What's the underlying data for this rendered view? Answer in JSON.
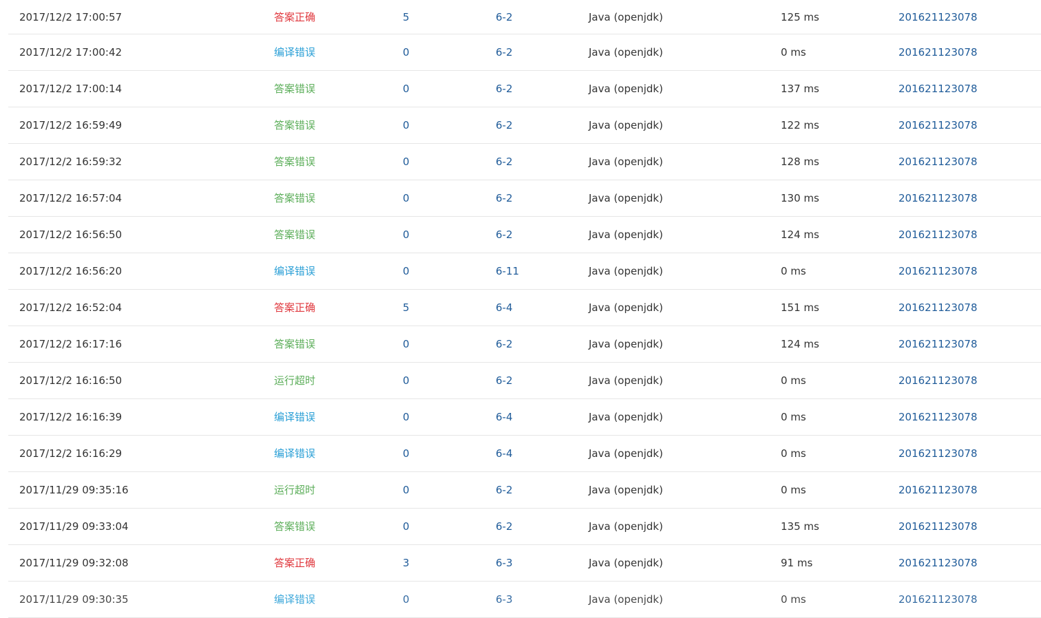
{
  "colors": {
    "correct": "#e0383e",
    "compile_error": "#2a9fd6",
    "wrong_answer": "#5cae5a",
    "timeout": "#5cae5a",
    "link": "#1f5b99",
    "text": "#333333",
    "divider": "#e6e6e6"
  },
  "rows": [
    {
      "time": "2017/12/2 17:00:57",
      "status": "答案正确",
      "score": "5",
      "problem": "6-2",
      "lang": "Java (openjdk)",
      "ms": "125 ms",
      "user": "201621123078"
    },
    {
      "time": "2017/12/2 17:00:42",
      "status": "编译错误",
      "score": "0",
      "problem": "6-2",
      "lang": "Java (openjdk)",
      "ms": "0 ms",
      "user": "201621123078"
    },
    {
      "time": "2017/12/2 17:00:14",
      "status": "答案错误",
      "score": "0",
      "problem": "6-2",
      "lang": "Java (openjdk)",
      "ms": "137 ms",
      "user": "201621123078"
    },
    {
      "time": "2017/12/2 16:59:49",
      "status": "答案错误",
      "score": "0",
      "problem": "6-2",
      "lang": "Java (openjdk)",
      "ms": "122 ms",
      "user": "201621123078"
    },
    {
      "time": "2017/12/2 16:59:32",
      "status": "答案错误",
      "score": "0",
      "problem": "6-2",
      "lang": "Java (openjdk)",
      "ms": "128 ms",
      "user": "201621123078"
    },
    {
      "time": "2017/12/2 16:57:04",
      "status": "答案错误",
      "score": "0",
      "problem": "6-2",
      "lang": "Java (openjdk)",
      "ms": "130 ms",
      "user": "201621123078"
    },
    {
      "time": "2017/12/2 16:56:50",
      "status": "答案错误",
      "score": "0",
      "problem": "6-2",
      "lang": "Java (openjdk)",
      "ms": "124 ms",
      "user": "201621123078"
    },
    {
      "time": "2017/12/2 16:56:20",
      "status": "编译错误",
      "score": "0",
      "problem": "6-11",
      "lang": "Java (openjdk)",
      "ms": "0 ms",
      "user": "201621123078"
    },
    {
      "time": "2017/12/2 16:52:04",
      "status": "答案正确",
      "score": "5",
      "problem": "6-4",
      "lang": "Java (openjdk)",
      "ms": "151 ms",
      "user": "201621123078"
    },
    {
      "time": "2017/12/2 16:17:16",
      "status": "答案错误",
      "score": "0",
      "problem": "6-2",
      "lang": "Java (openjdk)",
      "ms": "124 ms",
      "user": "201621123078"
    },
    {
      "time": "2017/12/2 16:16:50",
      "status": "运行超时",
      "score": "0",
      "problem": "6-2",
      "lang": "Java (openjdk)",
      "ms": "0 ms",
      "user": "201621123078"
    },
    {
      "time": "2017/12/2 16:16:39",
      "status": "编译错误",
      "score": "0",
      "problem": "6-4",
      "lang": "Java (openjdk)",
      "ms": "0 ms",
      "user": "201621123078"
    },
    {
      "time": "2017/12/2 16:16:29",
      "status": "编译错误",
      "score": "0",
      "problem": "6-4",
      "lang": "Java (openjdk)",
      "ms": "0 ms",
      "user": "201621123078"
    },
    {
      "time": "2017/11/29 09:35:16",
      "status": "运行超时",
      "score": "0",
      "problem": "6-2",
      "lang": "Java (openjdk)",
      "ms": "0 ms",
      "user": "201621123078"
    },
    {
      "time": "2017/11/29 09:33:04",
      "status": "答案错误",
      "score": "0",
      "problem": "6-2",
      "lang": "Java (openjdk)",
      "ms": "135 ms",
      "user": "201621123078"
    },
    {
      "time": "2017/11/29 09:32:08",
      "status": "答案正确",
      "score": "3",
      "problem": "6-3",
      "lang": "Java (openjdk)",
      "ms": "91 ms",
      "user": "201621123078"
    },
    {
      "time": "2017/11/29 09:30:35",
      "status": "编译错误",
      "score": "0",
      "problem": "6-3",
      "lang": "Java (openjdk)",
      "ms": "0 ms",
      "user": "201621123078"
    }
  ]
}
